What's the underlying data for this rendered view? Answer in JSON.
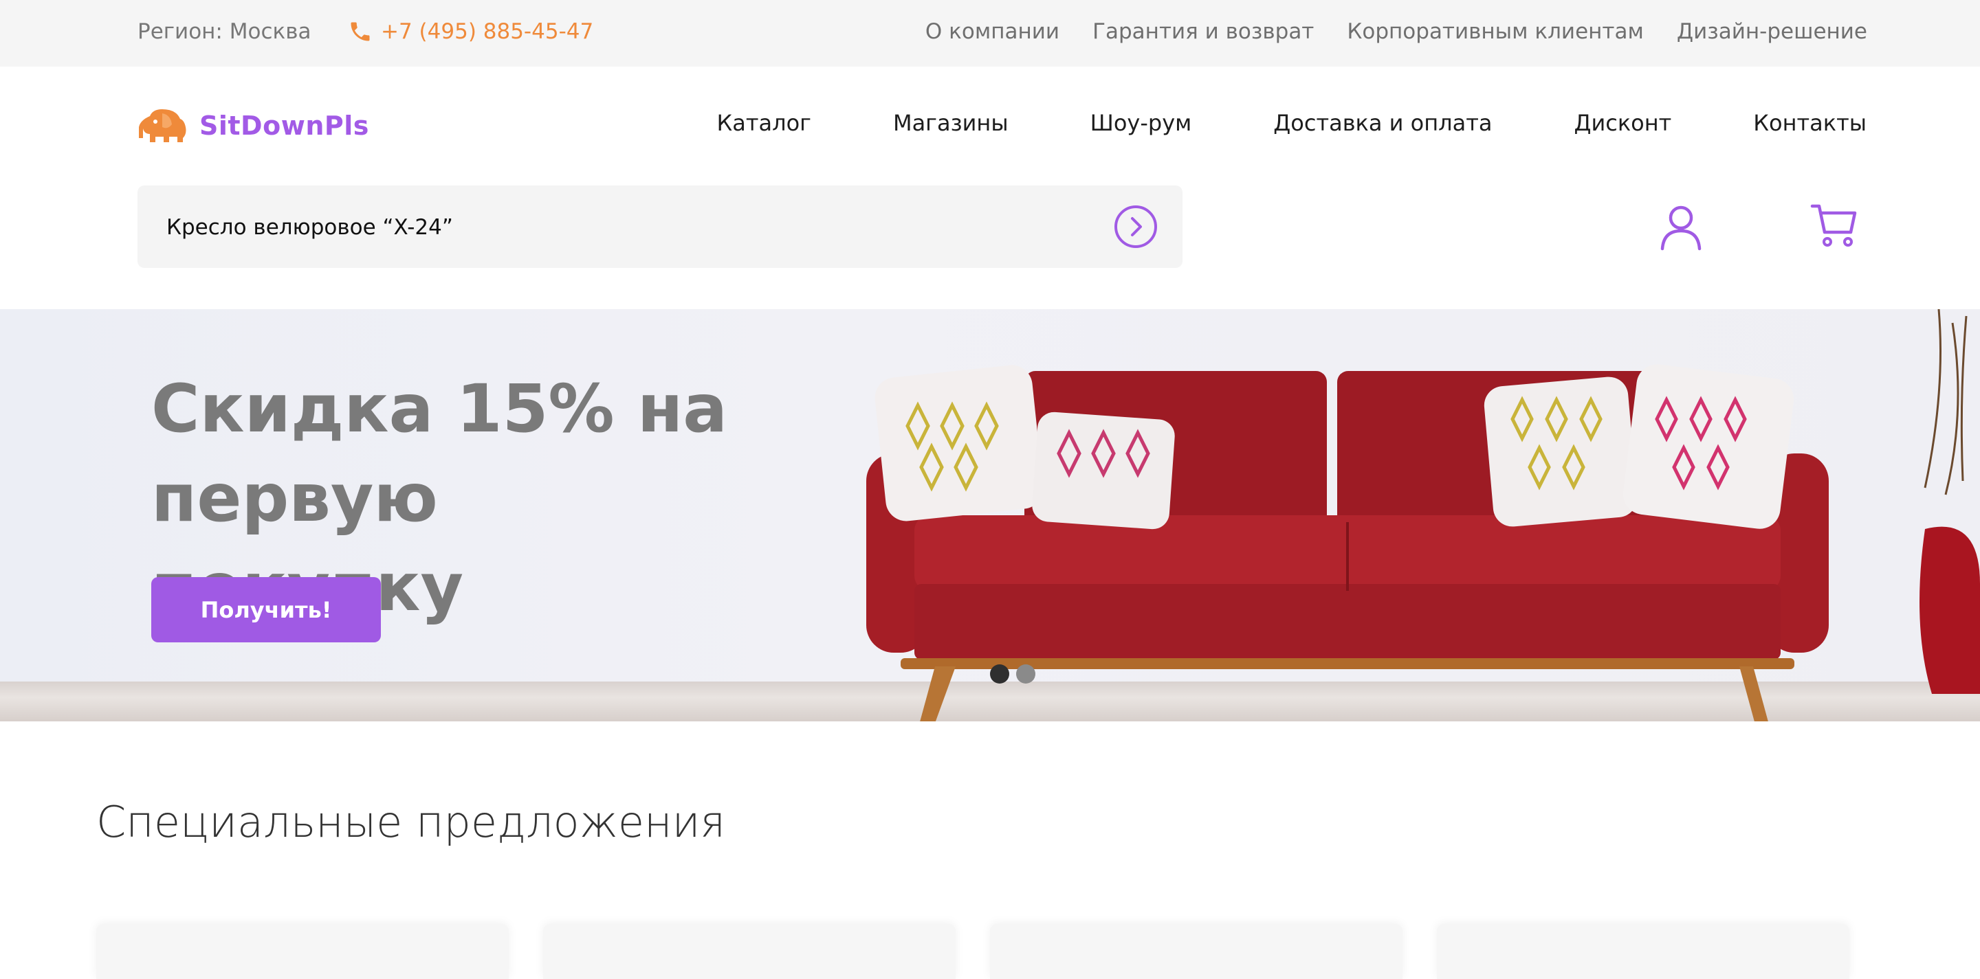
{
  "topbar": {
    "region": "Регион: Москва",
    "phone": "+7 (495) 885-45-47",
    "links": [
      "О компании",
      "Гарантия и возврат",
      "Корпоративным клиентам",
      "Дизайн-решение"
    ]
  },
  "header": {
    "logo_text": "SitDownPls",
    "nav": [
      "Каталог",
      "Магазины",
      "Шоу-рум",
      "Доставка и оплата",
      "Дисконт",
      "Контакты"
    ]
  },
  "search": {
    "value": "Кресло велюровое “X-24”"
  },
  "hero": {
    "title": "Скидка 15% на первую покупку",
    "button": "Получить!",
    "slides": 2,
    "active_slide": 1
  },
  "offers": {
    "title": "Специальные предложения",
    "card_count": 4
  },
  "colors": {
    "accent": "#a05ae4",
    "phone": "#ef8a3a",
    "sofa": "#a51e26",
    "logo": "#a25ae6"
  },
  "icons": [
    "phone-icon",
    "elephant-logo-icon",
    "chevron-right-icon",
    "user-icon",
    "cart-icon"
  ]
}
